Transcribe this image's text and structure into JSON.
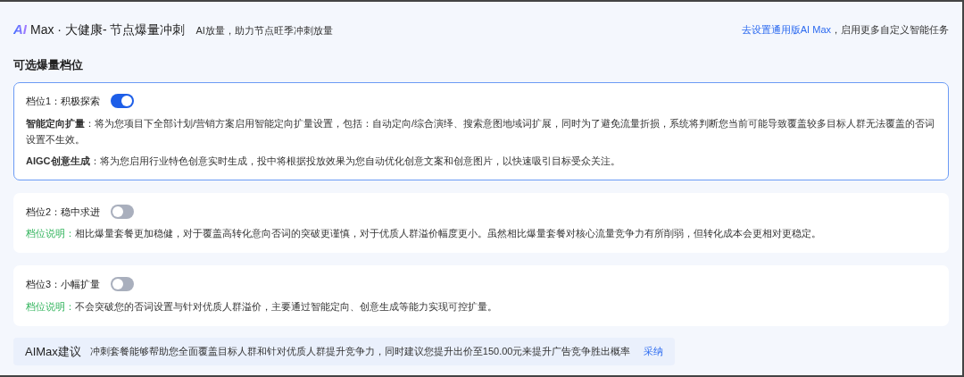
{
  "header": {
    "logo": "AI",
    "title": "Max · 大健康- 节点爆量冲刺",
    "subtitle": "AI放量，助力节点旺季冲刺放量",
    "link": "去设置通用版AI Max",
    "link_suffix": "，启用更多自定义智能任务"
  },
  "section_title": "可选爆量档位",
  "tiers": [
    {
      "kind": "detailed",
      "title": "档位1：积极探索",
      "selected": true,
      "on": true,
      "paragraphs": [
        "**智能定向扩量**：将为您项目下全部计划/营销方案启用智能定向扩量设置，包括：自动定向/综合演绎、搜索意图地域词扩展，同时为了避免流量折损，系统将判断您当前可能导致覆盖较多目标人群无法覆盖的否词设置不生效。",
        "**AIGC创意生成**：将为您启用行业特色创意实时生成，投中将根据投放效果为您自动优化创意文案和创意图片，以快速吸引目标受众关注。"
      ]
    },
    {
      "kind": "explained",
      "title": "档位2：稳中求进",
      "selected": false,
      "on": false,
      "label": "档位说明：",
      "text": "相比爆量套餐更加稳健，对于覆盖高转化意向否词的突破更谨慎，对于优质人群溢价幅度更小。虽然相比爆量套餐对核心流量竞争力有所削弱，但转化成本会更相对更稳定。"
    },
    {
      "kind": "explained",
      "title": "档位3：小幅扩量",
      "selected": false,
      "on": false,
      "label": "档位说明：",
      "text": "不会突破您的否词设置与针对优质人群溢价，主要通过智能定向、创意生成等能力实现可控扩量。"
    }
  ],
  "suggestion": {
    "title": "AIMax建议",
    "text": "冲刺套餐能够帮助您全面覆盖目标人群和针对优质人群提升竞争力，同时建议您提升出价至150.00元来提升广告竞争胜出概率",
    "action": "采纳"
  }
}
